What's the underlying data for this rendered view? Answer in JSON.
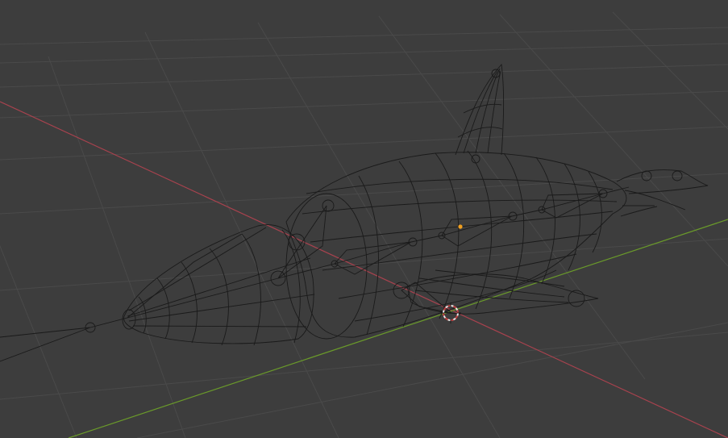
{
  "viewport": {
    "mode": "wireframe",
    "background_color": "#3d3d3d",
    "grid_color": "#4a4a4a",
    "x_axis_color": "#a8424e",
    "y_axis_color": "#6a9a2a",
    "wire_color": "#1a1a1a",
    "origin_color": "#f0a020",
    "cursor_colors": [
      "#e8e8e8",
      "#c04040"
    ]
  },
  "scene": {
    "objects": [
      "fish-body-mesh",
      "dorsal-fin-mesh",
      "pectoral-fin-mesh",
      "tail-fin-mesh",
      "head-cone-mesh",
      "armature-bones"
    ]
  }
}
